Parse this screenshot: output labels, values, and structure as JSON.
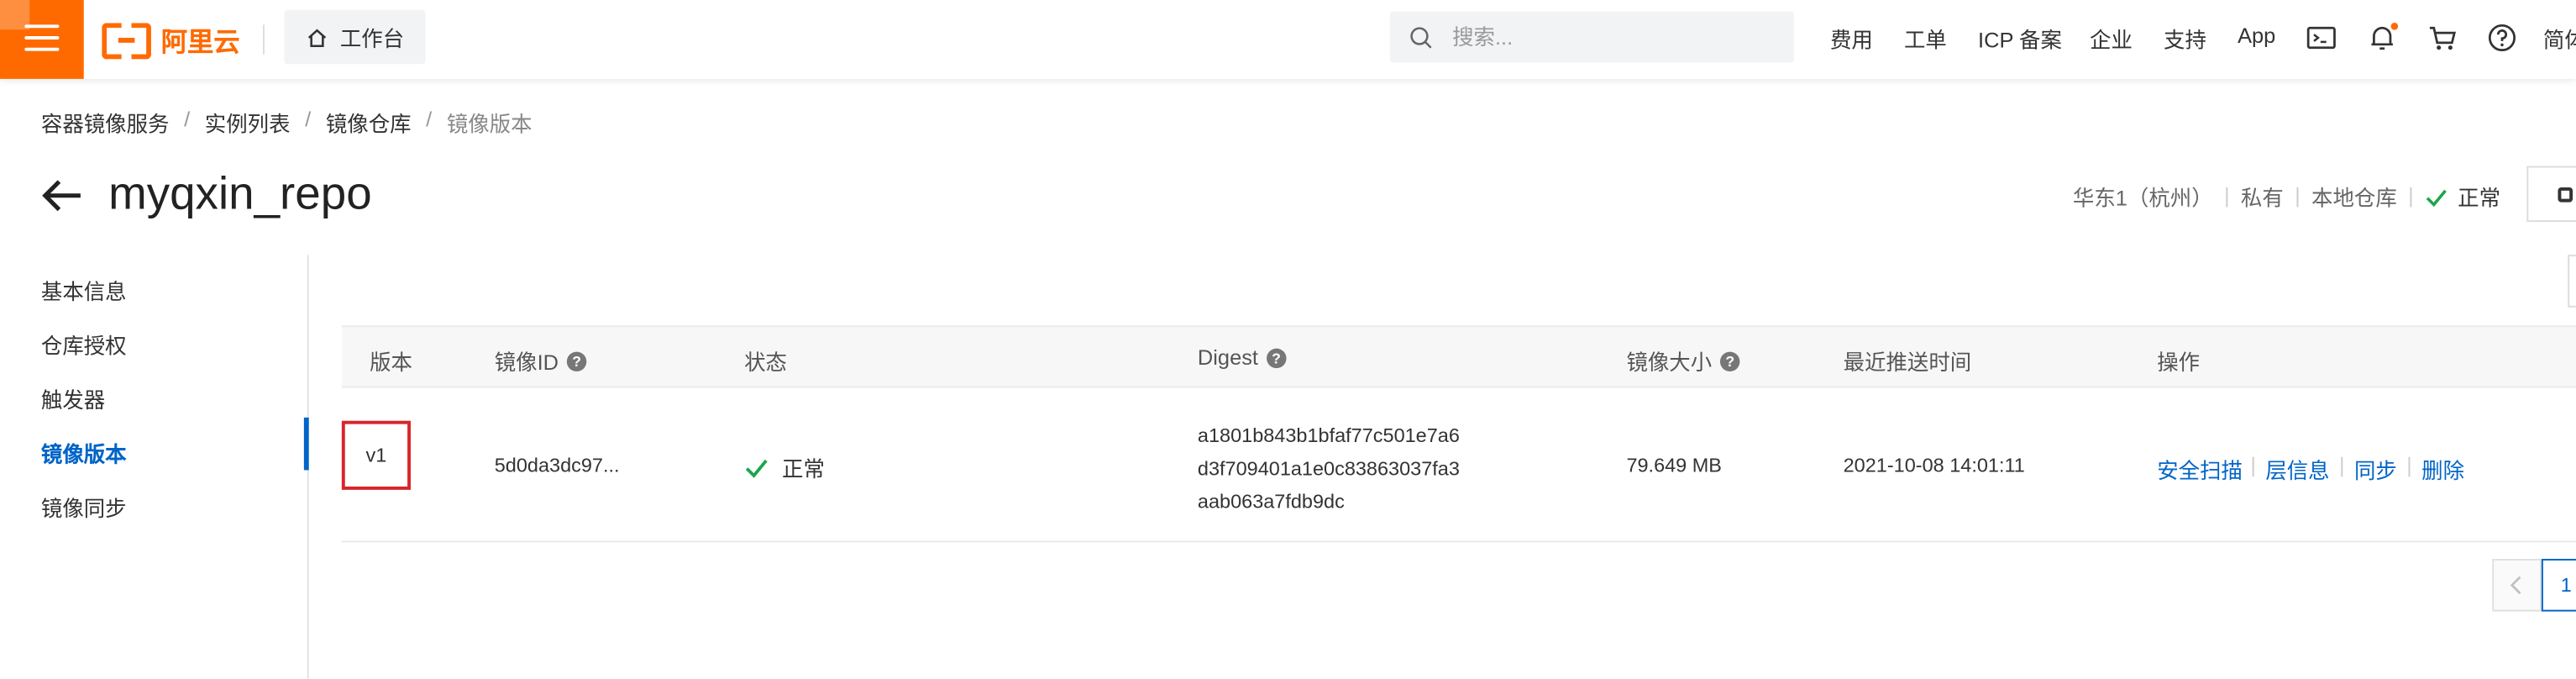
{
  "header": {
    "logo_text": "阿里云",
    "workbench_label": "工作台",
    "search_placeholder": "搜索...",
    "nav": [
      "费用",
      "工单",
      "ICP 备案",
      "企业",
      "支持",
      "App"
    ],
    "lang_label": "简体"
  },
  "breadcrumb": [
    "容器镜像服务",
    "实例列表",
    "镜像仓库",
    "镜像版本"
  ],
  "page": {
    "title": "myqxin_repo",
    "meta": {
      "region": "华东1（杭州）",
      "visibility": "私有",
      "repo_type": "本地仓库",
      "status": "正常"
    }
  },
  "sidebar": {
    "items": [
      "基本信息",
      "仓库授权",
      "触发器",
      "镜像版本",
      "镜像同步"
    ],
    "active": "镜像版本"
  },
  "table": {
    "columns": [
      "版本",
      "镜像ID",
      "状态",
      "Digest",
      "镜像大小",
      "最近推送时间",
      "操作"
    ],
    "rows": [
      {
        "version": "v1",
        "image_id": "5d0da3dc97...",
        "status": "正常",
        "digest_lines": [
          "a1801b843b1bfaf77c501e7a6",
          "d3f709401a1e0c83863037fa3",
          "aab063a7fdb9dc"
        ],
        "size": "79.649 MB",
        "pushed_at": "2021-10-08 14:01:11",
        "actions": [
          "安全扫描",
          "层信息",
          "同步",
          "删除"
        ]
      }
    ]
  },
  "pagination": {
    "current": "1"
  },
  "colors": {
    "brand": "#ff6a00",
    "link": "#0064c8",
    "success": "#1aa64a",
    "highlight": "#d9252b"
  }
}
